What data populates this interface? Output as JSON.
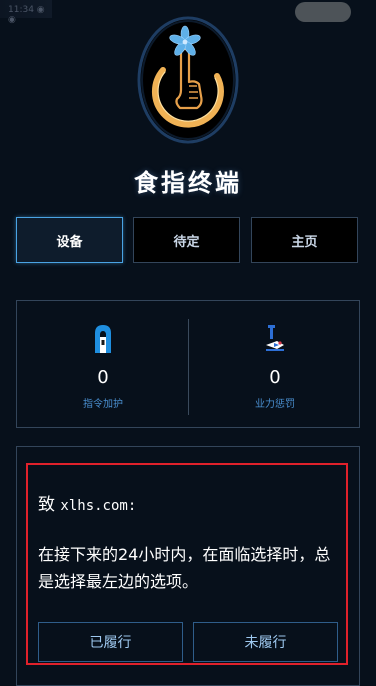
{
  "status": {
    "text": "11:34 ◉ ◉"
  },
  "app": {
    "title": "食指终端"
  },
  "tabs": [
    {
      "label": "设备",
      "active": true
    },
    {
      "label": "待定",
      "active": false
    },
    {
      "label": "主页",
      "active": false
    }
  ],
  "stats": {
    "left": {
      "value": "0",
      "label": "指令加护",
      "icon": "arch-shield-icon"
    },
    "right": {
      "value": "0",
      "label": "业力惩罚",
      "icon": "punishment-icon"
    }
  },
  "message": {
    "greeting_prefix": "致",
    "recipient": "xlhs.com:",
    "body": "在接下来的24小时内，在面临选择时，总是选择最左边的选项。",
    "done_label": "已履行",
    "undone_label": "未履行"
  },
  "colors": {
    "background": "#07101b",
    "accent": "#4aa3e4",
    "border": "#33455a",
    "stat_label": "#4a8fd0",
    "highlight": "#e0212b",
    "logo_gold": "#e7a04a",
    "logo_flower": "#5fb0e8"
  }
}
